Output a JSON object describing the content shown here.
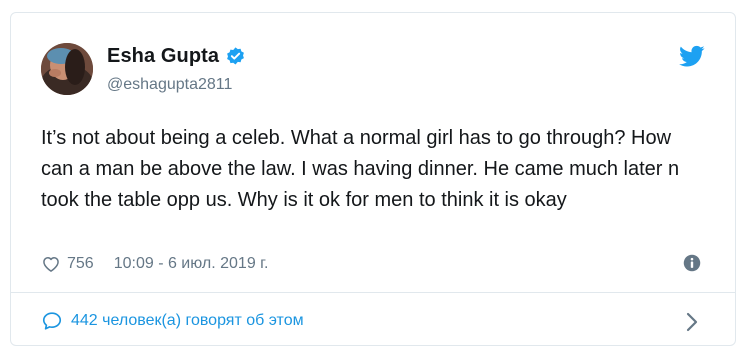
{
  "tweet": {
    "author": {
      "display_name": "Esha Gupta",
      "handle": "@eshagupta2811",
      "verified": true
    },
    "text": "It’s not about being a celeb. What a normal girl has to go through? How can a man be above the law. I was having dinner. He came much later n took the table opp us. Why is it ok for men to think it is okay",
    "likes": "756",
    "timestamp": "10:09 - 6 июл. 2019 г.",
    "conversation_label": "442 человек(а) говорят об этом"
  },
  "icons": {
    "brand": "twitter-bird-icon",
    "verified": "verified-badge-icon",
    "like": "heart-icon",
    "info": "info-icon",
    "reply": "speech-bubble-icon",
    "more": "chevron-right-icon"
  },
  "colors": {
    "accent": "#1da1f2",
    "link": "#1b95e0",
    "text": "#14171a",
    "muted": "#657786",
    "border": "#e1e8ed"
  }
}
